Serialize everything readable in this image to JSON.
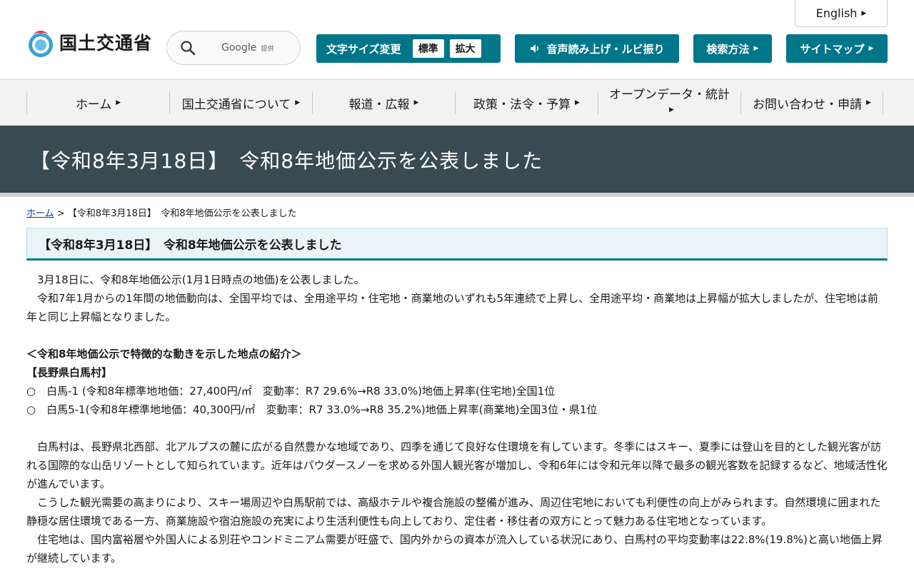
{
  "header": {
    "logo_text": "国土交通省",
    "search": {
      "google_label": "Google",
      "provided_label": "提供"
    },
    "english_label": "English",
    "font_size": {
      "label": "文字サイズ変更",
      "standard": "標準",
      "large": "拡大"
    },
    "speech_label": "音声読み上げ・ルビ振り",
    "search_method_label": "検索方法",
    "sitemap_label": "サイトマップ"
  },
  "nav": {
    "items": [
      {
        "label": "ホーム"
      },
      {
        "label": "国土交通省について"
      },
      {
        "label": "報道・広報"
      },
      {
        "label": "政策・法令・予算"
      },
      {
        "label": "オープンデータ・統計"
      },
      {
        "label": "お問い合わせ・申請"
      }
    ]
  },
  "banner": {
    "title": "【令和8年3月18日】　令和8年地価公示を公表しました"
  },
  "breadcrumb": {
    "home": "ホーム",
    "separator": " > ",
    "current": "【令和8年3月18日】　令和8年地価公示を公表しました"
  },
  "content": {
    "heading": "【令和8年3月18日】　令和8年地価公示を公表しました",
    "para1": "3月18日に、令和8年地価公示(1月1日時点の地価)を公表しました。",
    "para2": "令和7年1月からの1年間の地価動向は、全国平均では、全用途平均・住宅地・商業地のいずれも5年連続で上昇し、全用途平均・商業地は上昇幅が拡大しましたが、住宅地は前年と同じ上昇幅となりました。",
    "section_title": "＜令和8年地価公示で特徴的な動きを示した地点の紹介＞",
    "region_title": "【長野県白馬村】",
    "bullets": [
      "○　白馬-1 (令和8年標準地地価：27,400円/㎡　変動率：R7 29.6%→R8 33.0%)地価上昇率(住宅地)全国1位",
      "○　白馬5-1(令和8年標準地地価：40,300円/㎡　変動率：R7 33.0%→R8 35.2%)地価上昇率(商業地)全国3位・県1位"
    ],
    "desc1": "白馬村は、長野県北西部、北アルプスの麓に広がる自然豊かな地域であり、四季を通じて良好な住環境を有しています。冬季にはスキー、夏季には登山を目的とした観光客が訪れる国際的な山岳リゾートとして知られています。近年はパウダースノーを求める外国人観光客が増加し、令和6年には令和元年以降で最多の観光客数を記録するなど、地域活性化が進んでいます。",
    "desc2": "こうした観光需要の高まりにより、スキー場周辺や白馬駅前では、高級ホテルや複合施設の整備が進み、周辺住宅地においても利便性の向上がみられます。自然環境に囲まれた静穏な居住環境である一方、商業施設や宿泊施設の充実により生活利便性も向上しており、定住者・移住者の双方にとって魅力ある住宅地となっています。",
    "desc3": "住宅地は、国内富裕層や外国人による別荘やコンドミニアム需要が旺盛で、国内外からの資本が流入している状況にあり、白馬村の平均変動率は22.8%(19.8%)と高い地価上昇が継続しています。"
  },
  "colors": {
    "accent": "#00768a",
    "banner": "#3a4a52",
    "link": "#0b3c9c"
  }
}
